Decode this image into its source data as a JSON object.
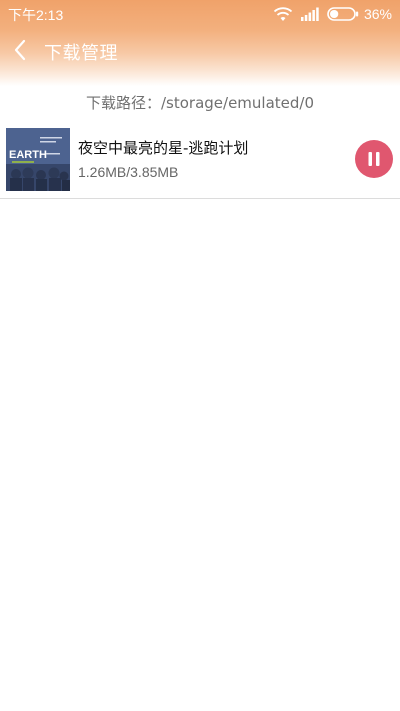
{
  "status_bar": {
    "time": "下午2:13",
    "battery_percent": "36%",
    "battery_level": 0.36,
    "icons": [
      "wifi-icon",
      "signal-icon",
      "battery-icon"
    ]
  },
  "toolbar": {
    "title": "下载管理",
    "back_icon": "chevron-left-icon"
  },
  "download_path": "下载路径：/storage/emulated/0",
  "downloads": [
    {
      "title": "夜空中最亮的星-逃跑计划",
      "size": "1.26MB/3.85MB",
      "progress": 0.327,
      "action_icon": "pause-icon",
      "cover_text": "EARTH"
    }
  ],
  "colors": {
    "header_gradient_top": "#f0a26a",
    "accent": "#e0576f",
    "path_text": "#707070"
  }
}
